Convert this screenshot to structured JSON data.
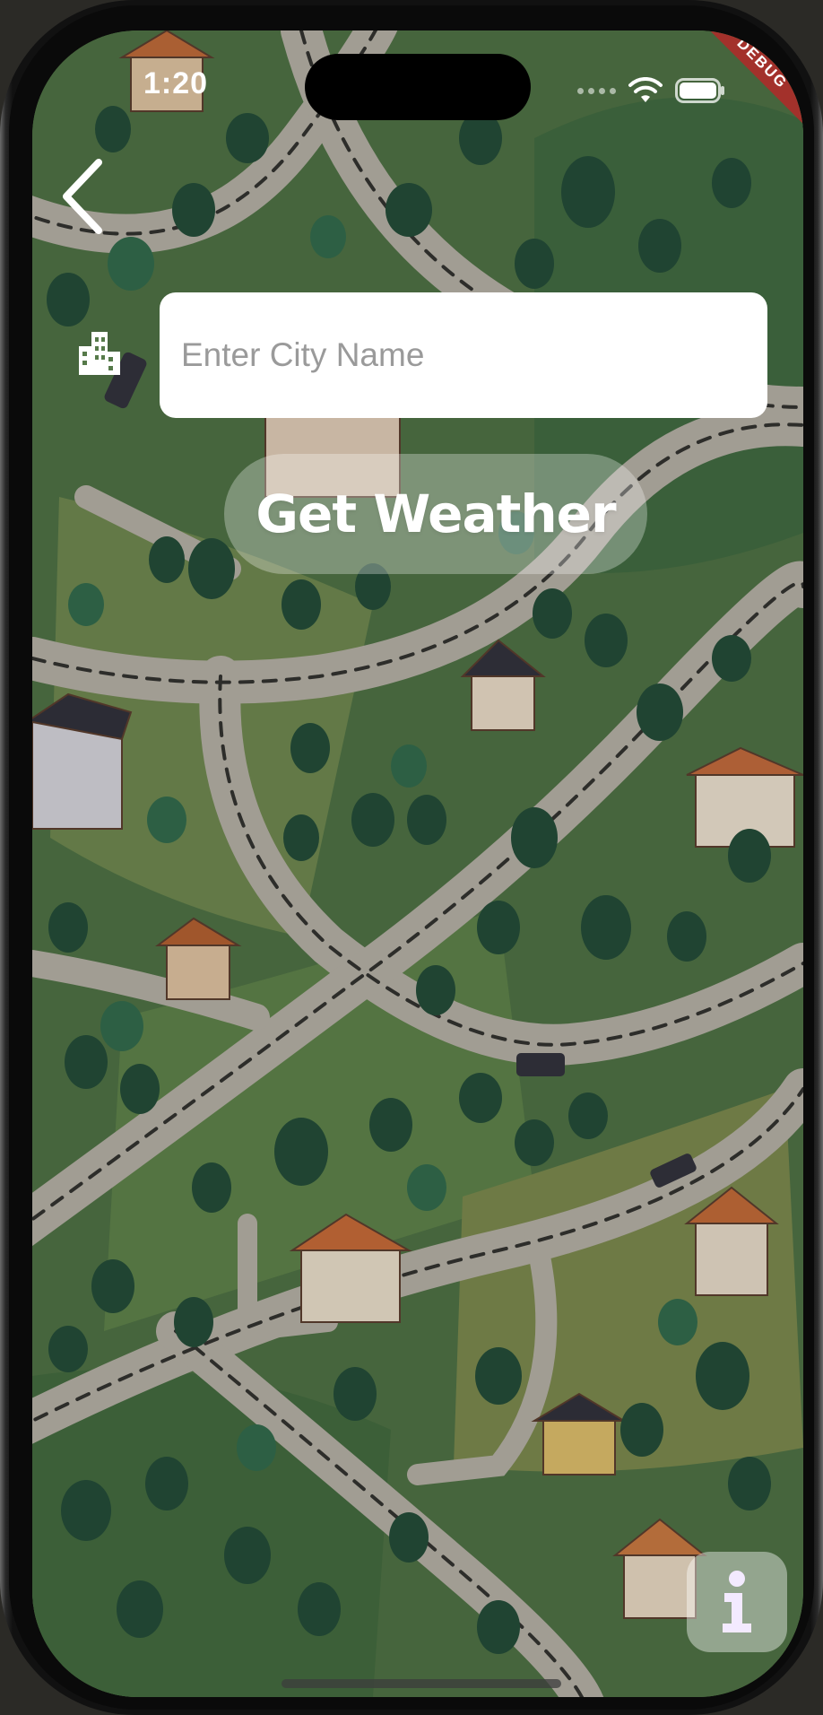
{
  "status_bar": {
    "time": "1:20",
    "debug_banner": "DEBUG"
  },
  "navigation": {
    "back_icon": "chevron-left-icon"
  },
  "search": {
    "field_icon": "city-buildings-icon",
    "placeholder": "Enter City Name",
    "value": ""
  },
  "actions": {
    "get_weather_label": "Get Weather",
    "info_icon": "info-icon"
  },
  "colors": {
    "map_green": "#4b6f3f",
    "road_gray": "#b9b4a8",
    "tree_dark": "#1e4a34",
    "button_white_translucent": "rgba(255,255,255,0.30)"
  }
}
